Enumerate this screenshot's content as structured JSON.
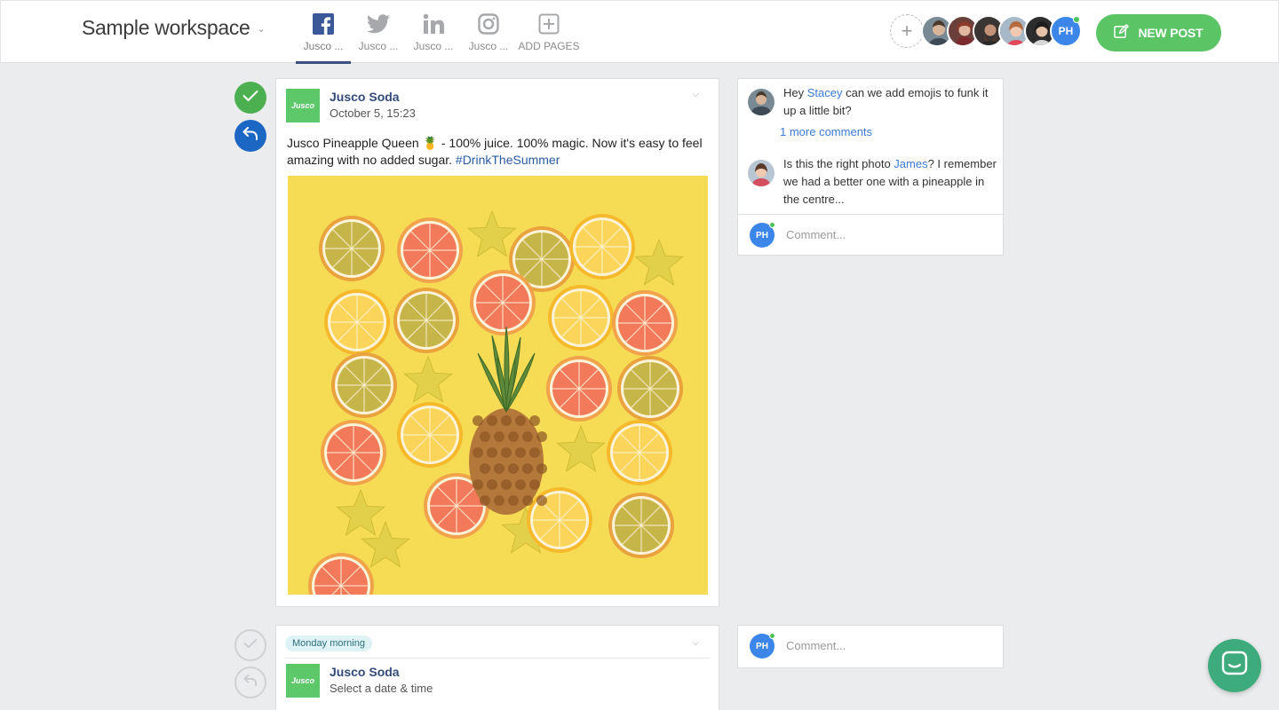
{
  "header": {
    "workspace_name": "Sample workspace",
    "tabs": [
      {
        "label": "Jusco ...",
        "icon": "facebook-icon",
        "active": true
      },
      {
        "label": "Jusco ...",
        "icon": "twitter-icon",
        "active": false
      },
      {
        "label": "Jusco ...",
        "icon": "linkedin-icon",
        "active": false
      },
      {
        "label": "Jusco ...",
        "icon": "instagram-icon",
        "active": false
      },
      {
        "label": "ADD PAGES",
        "icon": "add-page-icon",
        "active": false
      }
    ],
    "current_user_initials": "PH",
    "new_post_label": "NEW POST"
  },
  "posts": [
    {
      "page_name": "Jusco Soda",
      "logo_text": "Jusco",
      "date": "October 5,  15:23",
      "text_before": "Jusco Pineapple Queen 🍍 - 100% juice. 100% magic. Now it's easy to feel amazing with no added sugar. ",
      "hashtag": "#DrinkTheSummer"
    },
    {
      "badge": "Monday morning",
      "page_name": "Jusco Soda",
      "logo_text": "Jusco",
      "date": "Select a date & time"
    }
  ],
  "comments": {
    "items": [
      {
        "before": "Hey ",
        "mention": "Stacey",
        "after": " can we add emojis to funk it up a little bit?"
      },
      {
        "before": "Is this the right photo ",
        "mention": "James",
        "after": "? I remember we had a better one with a pineapple in the centre..."
      }
    ],
    "more_comments": "1 more comments",
    "input_placeholder": "Comment...",
    "user_initials": "PH"
  },
  "colors": {
    "accent_green": "#5bc565",
    "approve_green": "#4cb050",
    "reply_blue": "#1d67c4",
    "brand_navy": "#334b7a",
    "mention_blue": "#3a7bd5",
    "chat_green": "#3dab7b"
  }
}
